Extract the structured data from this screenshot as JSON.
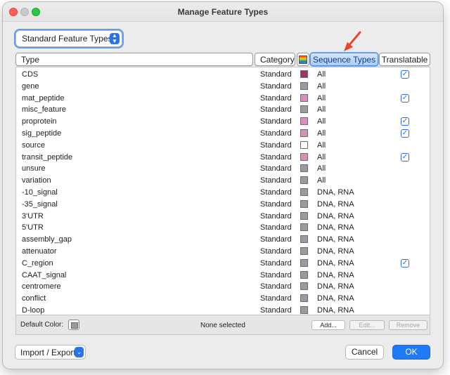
{
  "window": {
    "title": "Manage Feature Types"
  },
  "popup": {
    "label": "Standard Feature Types"
  },
  "columns": {
    "type": "Type",
    "category": "Category",
    "sequence_types": "Sequence Types",
    "translatable": "Translatable"
  },
  "rows": [
    {
      "type": "CDS",
      "category": "Standard",
      "color": "#a1336b",
      "seq": "All",
      "translatable": true
    },
    {
      "type": "gene",
      "category": "Standard",
      "color": "#9a9aa4",
      "seq": "All",
      "translatable": false
    },
    {
      "type": "mat_peptide",
      "category": "Standard",
      "color": "#d88fb9",
      "seq": "All",
      "translatable": true
    },
    {
      "type": "misc_feature",
      "category": "Standard",
      "color": "#9a9aa4",
      "seq": "All",
      "translatable": false
    },
    {
      "type": "proprotein",
      "category": "Standard",
      "color": "#d88fb9",
      "seq": "All",
      "translatable": true
    },
    {
      "type": "sig_peptide",
      "category": "Standard",
      "color": "#d88fb9",
      "seq": "All",
      "translatable": true
    },
    {
      "type": "source",
      "category": "Standard",
      "color": "#ffffff",
      "seq": "All",
      "translatable": false
    },
    {
      "type": "transit_peptide",
      "category": "Standard",
      "color": "#d88fb9",
      "seq": "All",
      "translatable": true
    },
    {
      "type": "unsure",
      "category": "Standard",
      "color": "#9a9aa4",
      "seq": "All",
      "translatable": false
    },
    {
      "type": "variation",
      "category": "Standard",
      "color": "#9a9aa4",
      "seq": "All",
      "translatable": false
    },
    {
      "type": "-10_signal",
      "category": "Standard",
      "color": "#9a9aa4",
      "seq": "DNA, RNA",
      "translatable": false
    },
    {
      "type": "-35_signal",
      "category": "Standard",
      "color": "#9a9aa4",
      "seq": "DNA, RNA",
      "translatable": false
    },
    {
      "type": "3'UTR",
      "category": "Standard",
      "color": "#9a9aa4",
      "seq": "DNA, RNA",
      "translatable": false
    },
    {
      "type": "5'UTR",
      "category": "Standard",
      "color": "#9a9aa4",
      "seq": "DNA, RNA",
      "translatable": false
    },
    {
      "type": "assembly_gap",
      "category": "Standard",
      "color": "#9a9aa4",
      "seq": "DNA, RNA",
      "translatable": false
    },
    {
      "type": "attenuator",
      "category": "Standard",
      "color": "#9a9aa4",
      "seq": "DNA, RNA",
      "translatable": false
    },
    {
      "type": "C_region",
      "category": "Standard",
      "color": "#9a9aa4",
      "seq": "DNA, RNA",
      "translatable": true
    },
    {
      "type": "CAAT_signal",
      "category": "Standard",
      "color": "#9a9aa4",
      "seq": "DNA, RNA",
      "translatable": false
    },
    {
      "type": "centromere",
      "category": "Standard",
      "color": "#9a9aa4",
      "seq": "DNA, RNA",
      "translatable": false
    },
    {
      "type": "conflict",
      "category": "Standard",
      "color": "#9a9aa4",
      "seq": "DNA, RNA",
      "translatable": false
    },
    {
      "type": "D-loop",
      "category": "Standard",
      "color": "#9a9aa4",
      "seq": "DNA, RNA",
      "translatable": false
    }
  ],
  "footer": {
    "default_color_label": "Default Color:",
    "selection_label": "None selected",
    "add_label": "Add...",
    "edit_label": "Edit...",
    "remove_label": "Remove"
  },
  "bottom": {
    "import_export_label": "Import / Export",
    "cancel_label": "Cancel",
    "ok_label": "OK"
  },
  "colors": {
    "accent": "#1f7bf5",
    "annotation_arrow": "#e8452c"
  }
}
